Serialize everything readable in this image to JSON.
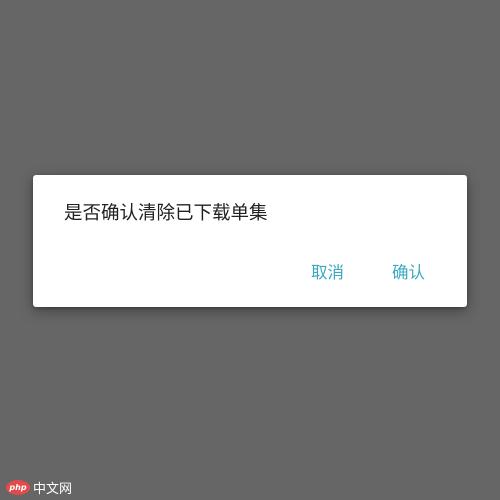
{
  "dialog": {
    "message": "是否确认清除已下载单集",
    "cancel_label": "取消",
    "confirm_label": "确认"
  },
  "watermark": {
    "logo_text": "php",
    "text": "中文网"
  },
  "colors": {
    "backdrop": "#666666",
    "dialog_background": "#ffffff",
    "message_text": "#212121",
    "accent": "#3aa8c1"
  }
}
